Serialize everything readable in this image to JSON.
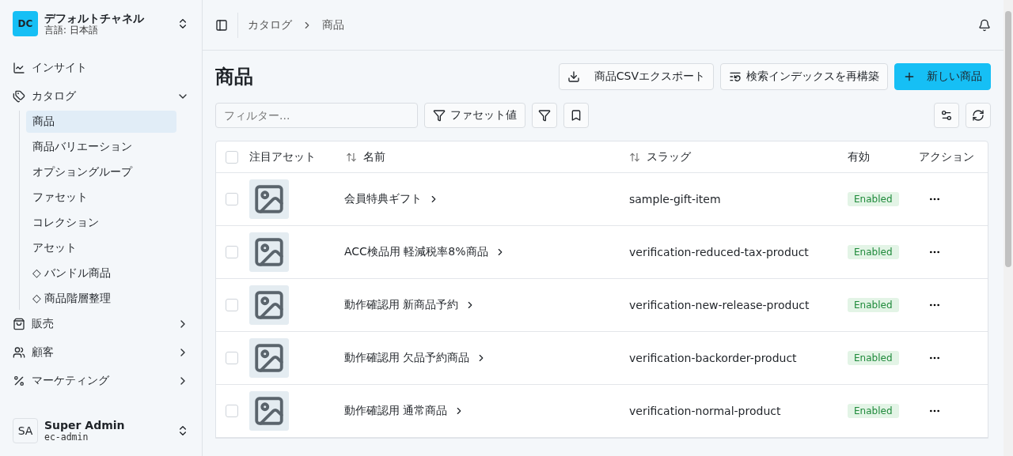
{
  "channel": {
    "initials": "DC",
    "name": "デフォルトチャネル",
    "language": "言語: 日本語"
  },
  "nav": [
    {
      "label": "インサイト",
      "kind": "chart"
    },
    {
      "label": "カタログ",
      "kind": "tags",
      "expanded": true,
      "children": [
        {
          "label": "商品",
          "selected": true
        },
        {
          "label": "商品バリエーション",
          "selected": false
        },
        {
          "label": "オプショングループ",
          "selected": false
        },
        {
          "label": "ファセット",
          "selected": false
        },
        {
          "label": "コレクション",
          "selected": false
        },
        {
          "label": "アセット",
          "selected": false
        },
        {
          "label": "◇ バンドル商品",
          "selected": false
        },
        {
          "label": "◇ 商品階層整理",
          "selected": false
        }
      ]
    },
    {
      "label": "販売",
      "kind": "bag",
      "expanded": false
    },
    {
      "label": "顧客",
      "kind": "users",
      "expanded": false
    },
    {
      "label": "マーケティング",
      "kind": "percent",
      "expanded": false
    }
  ],
  "user": {
    "initials": "SA",
    "name": "Super Admin",
    "login": "ec-admin"
  },
  "breadcrumb": [
    "カタログ",
    "商品"
  ],
  "page_title": "商品",
  "actions": [
    {
      "kind": "export",
      "label": "商品CSVエクスポート"
    },
    {
      "kind": "reindex",
      "label": "検索インデックスを再構築"
    },
    {
      "kind": "create",
      "label": "新しい商品"
    }
  ],
  "filter": {
    "placeholder": "フィルター..."
  },
  "facet_button": "ファセット値",
  "table": {
    "all_checked": false,
    "columns": [
      {
        "label": "注目アセット",
        "sortable": false
      },
      {
        "label": "名前",
        "sortable": true
      },
      {
        "label": "スラッグ",
        "sortable": true
      },
      {
        "label": "有効",
        "sortable": false
      },
      {
        "label": "アクション",
        "sortable": false
      }
    ],
    "rows": [
      {
        "name": "会員特典ギフト",
        "slug": "sample-gift-item",
        "status": "Enabled",
        "checked": false
      },
      {
        "name": "ACC検品用 軽減税率8%商品",
        "slug": "verification-reduced-tax-product",
        "status": "Enabled",
        "checked": false
      },
      {
        "name": "動作確認用 新商品予約",
        "slug": "verification-new-release-product",
        "status": "Enabled",
        "checked": false
      },
      {
        "name": "動作確認用 欠品予約商品",
        "slug": "verification-backorder-product",
        "status": "Enabled",
        "checked": false
      },
      {
        "name": "動作確認用 通常商品",
        "slug": "verification-normal-product",
        "status": "Enabled",
        "checked": false
      }
    ]
  }
}
